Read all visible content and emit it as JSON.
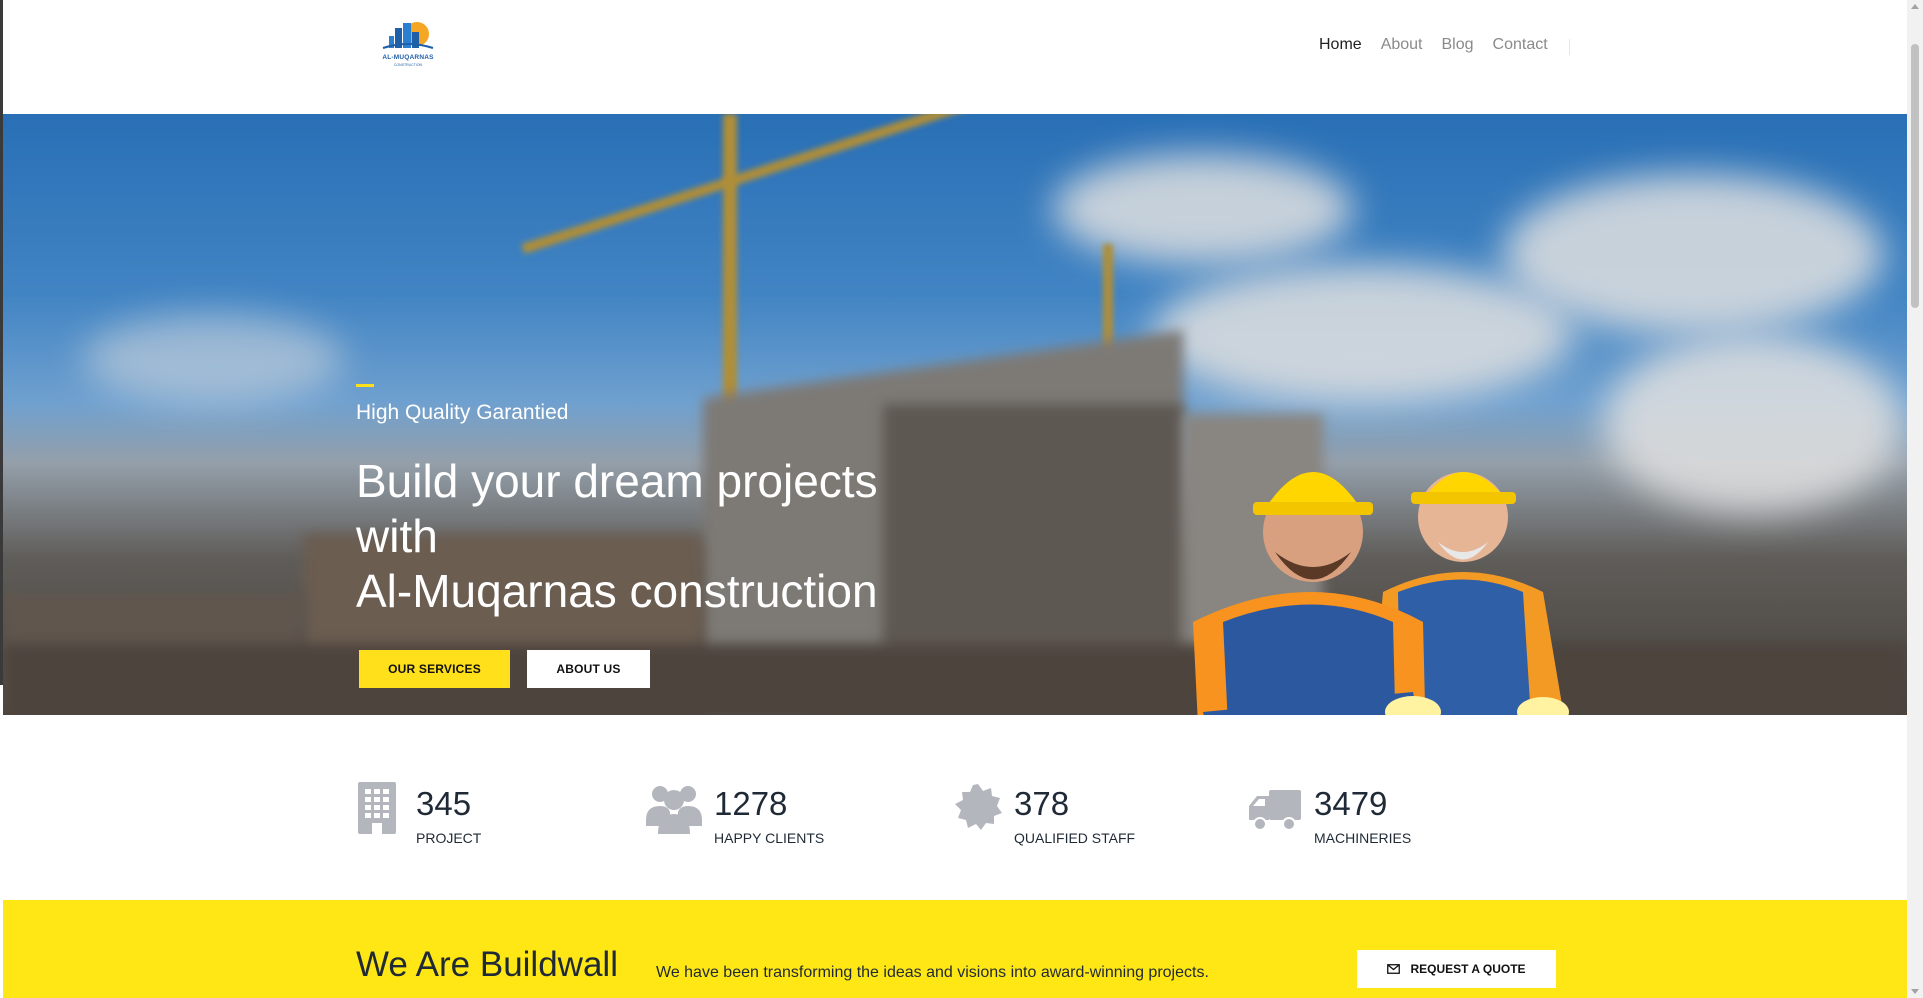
{
  "header": {
    "logo": {
      "name": "AL-MUQARNAS",
      "sub": "CONSTRUCTION"
    },
    "nav": [
      {
        "label": "Home",
        "active": true
      },
      {
        "label": "About",
        "active": false
      },
      {
        "label": "Blog",
        "active": false
      },
      {
        "label": "Contact",
        "active": false
      }
    ]
  },
  "hero": {
    "subtitle": "High Quality Garantied",
    "title_lines": [
      "Build your dream projects",
      "with",
      "Al-Muqarnas construction"
    ],
    "buttons": {
      "services": "OUR SERVICES",
      "about": "ABOUT US"
    }
  },
  "stats": [
    {
      "value": "345",
      "label": "PROJECT",
      "icon": "building-icon"
    },
    {
      "value": "1278",
      "label": "HAPPY CLIENTS",
      "icon": "users-icon"
    },
    {
      "value": "378",
      "label": "QUALIFIED STAFF",
      "icon": "badge-icon"
    },
    {
      "value": "3479",
      "label": "MACHINERIES",
      "icon": "truck-icon"
    }
  ],
  "band": {
    "title": "We Are Buildwall",
    "text": "We have been transforming the ideas and visions into award-winning projects.",
    "quote_button": "REQUEST A QUOTE"
  },
  "colors": {
    "accent": "#ffe01a",
    "band": "#ffe615",
    "text_dark": "#1f2a36"
  }
}
